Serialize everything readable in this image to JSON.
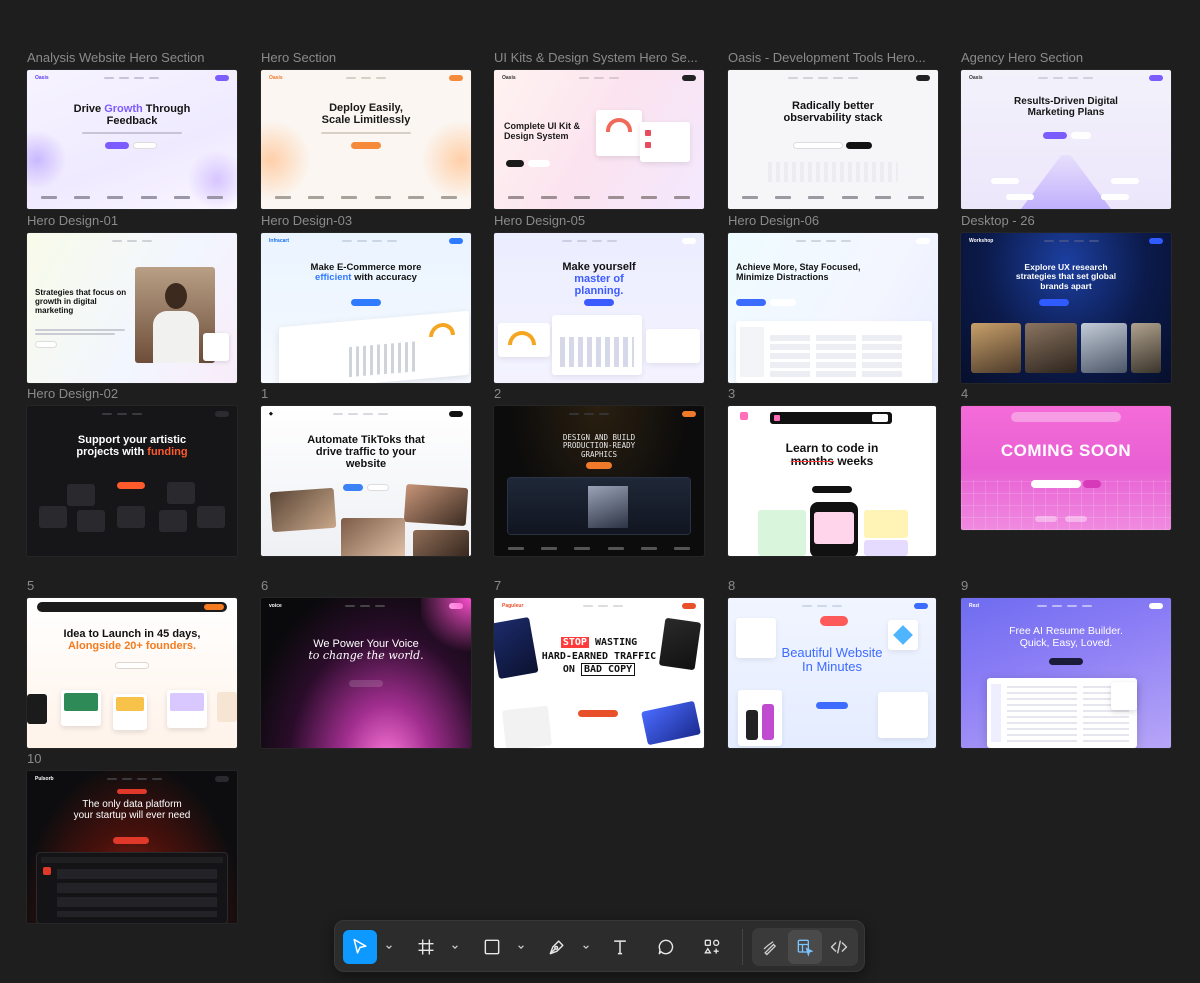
{
  "frames": [
    {
      "label": "Analysis Website Hero Section",
      "logo": "Oasis",
      "headline": [
        "Drive ",
        "Growth",
        " Through Feedback"
      ],
      "theme": "light-purple"
    },
    {
      "label": "Hero Section",
      "logo": "Oasis",
      "headline": [
        "Deploy Easily, Scale Limitlessly"
      ],
      "theme": "light-orange"
    },
    {
      "label": "UI Kits & Design System Hero Se...",
      "logo": "Oasis",
      "headline": [
        "Complete UI Kit & Design System"
      ],
      "theme": "light-pink"
    },
    {
      "label": "Oasis - Development Tools Hero...",
      "logo": "",
      "headline": [
        "Radically better observability stack"
      ],
      "theme": "light-gray"
    },
    {
      "label": "Agency Hero Section",
      "logo": "Oasis",
      "headline": [
        "Results-Driven Digital Marketing Plans"
      ],
      "theme": "light-violet"
    },
    {
      "label": "Hero Design-01",
      "logo": "",
      "headline": [
        "Strategies that focus on growth in digital marketing"
      ],
      "theme": "light-green"
    },
    {
      "label": "Hero Design-03",
      "logo": "Infracart",
      "headline": [
        "Make E-Commerce more ",
        "efficient",
        " with accuracy"
      ],
      "theme": "light-blue"
    },
    {
      "label": "Hero Design-05",
      "logo": "",
      "headline": [
        "Make yourself ",
        "master of planning."
      ],
      "theme": "light-lavender"
    },
    {
      "label": "Hero Design-06",
      "logo": "",
      "headline": [
        "Achieve More, Stay Focused, Minimize Distractions"
      ],
      "theme": "light-cyan"
    },
    {
      "label": "Desktop - 26",
      "logo": "Workshop",
      "headline": [
        "Explore UX research strategies that set global brands apart"
      ],
      "theme": "dark-navy"
    },
    {
      "label": "Hero Design-02",
      "logo": "",
      "headline": [
        "Support your artistic projects with ",
        "funding"
      ],
      "theme": "dark"
    },
    {
      "label": "1",
      "logo": "",
      "headline": [
        "Automate TikToks that drive traffic to your website"
      ],
      "theme": "light-white"
    },
    {
      "label": "2",
      "logo": "",
      "headline": [
        "DESIGN AND BUILD PRODUCTION-READY GRAPHICS"
      ],
      "theme": "dark-black"
    },
    {
      "label": "3",
      "logo": "",
      "headline": [
        "Learn to code in ",
        "months",
        " weeks"
      ],
      "theme": "white-pink"
    },
    {
      "label": "4",
      "logo": "",
      "headline": [
        "COMING",
        "SOON"
      ],
      "theme": "magenta"
    },
    {
      "label": "5",
      "logo": "",
      "headline": [
        "Idea to Launch in 45 days,",
        "Alongside 20+ founders."
      ],
      "theme": "cream"
    },
    {
      "label": "6",
      "logo": "",
      "headline": [
        "We Power Your Voice",
        "to change the world."
      ],
      "theme": "dark-pink"
    },
    {
      "label": "7",
      "logo": "Paguleur",
      "headline": [
        "STOP",
        "WASTING",
        "HARD-EARNED TRAFFIC",
        "ON",
        "BAD COPY"
      ],
      "theme": "white-red"
    },
    {
      "label": "8",
      "logo": "",
      "headline": [
        "Beautiful Website",
        "In Minutes"
      ],
      "theme": "white-blue"
    },
    {
      "label": "9",
      "logo": "Rezi",
      "headline": [
        "Free AI Resume Builder.",
        "Quick, Easy, Loved."
      ],
      "theme": "indigo"
    },
    {
      "label": "10",
      "logo": "Pulsorb",
      "headline": [
        "The only data platform your startup will ever need"
      ],
      "theme": "dark-red"
    }
  ],
  "toolbar": {
    "tools": [
      "move-tool",
      "frame-tool",
      "shape-tool",
      "pen-tool",
      "text-tool",
      "comment-tool",
      "actions-tool"
    ],
    "modes": [
      "draw-mode",
      "design-mode",
      "dev-mode"
    ],
    "active_tool": "move-tool",
    "active_mode": "design-mode",
    "accent": "#0d99ff"
  }
}
